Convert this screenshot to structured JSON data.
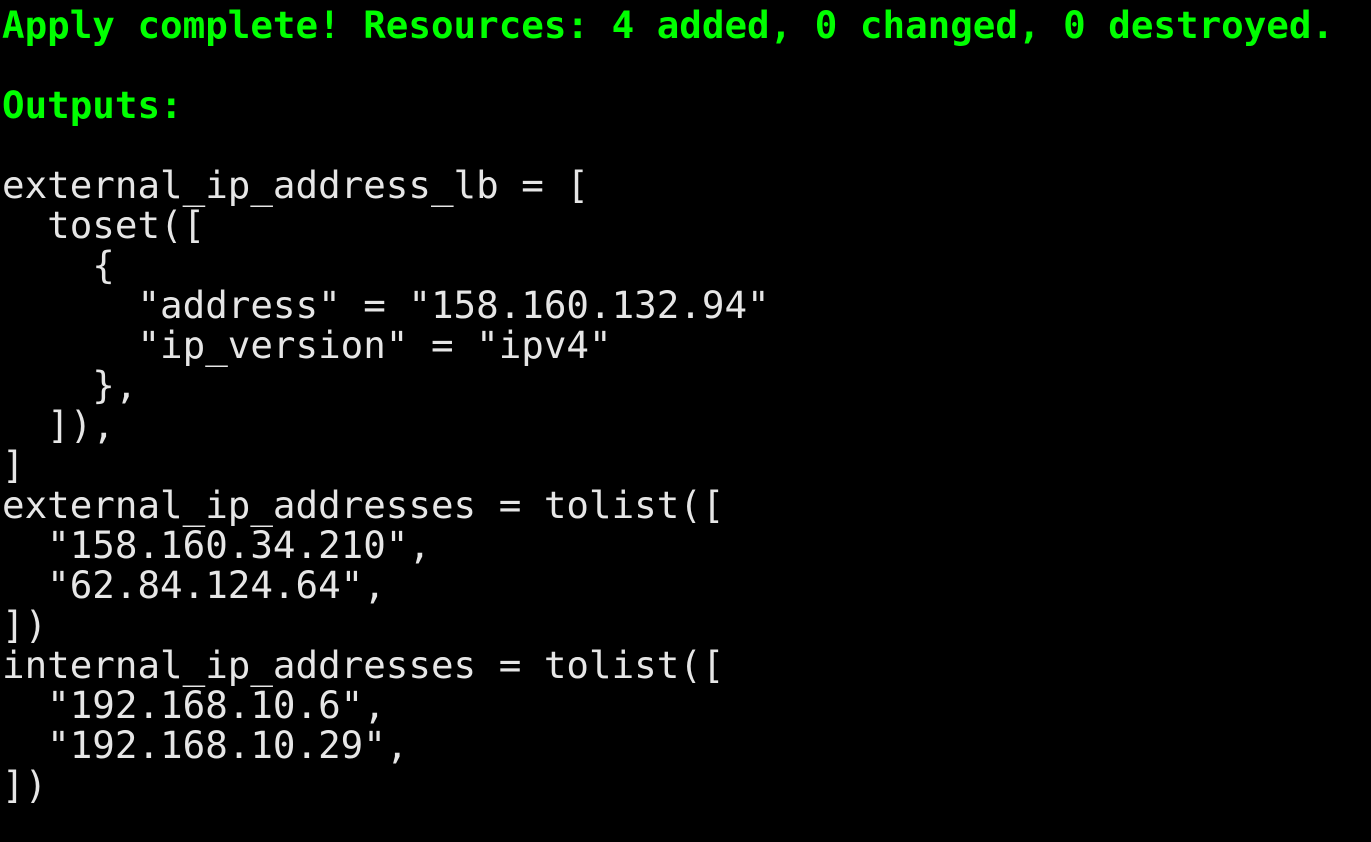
{
  "colors": {
    "background": "#000000",
    "success_text": "#00ff00",
    "output_text": "#e6e6e6"
  },
  "terminal": {
    "lines": [
      "Apply complete! Resources: 4 added, 0 changed, 0 destroyed.",
      "",
      "Outputs:",
      "",
      "external_ip_address_lb = [",
      "  toset([",
      "    {",
      "      \"address\" = \"158.160.132.94\"",
      "      \"ip_version\" = \"ipv4\"",
      "    },",
      "  ]),",
      "]",
      "external_ip_addresses = tolist([",
      "  \"158.160.34.210\",",
      "  \"62.84.124.64\",",
      "])",
      "internal_ip_addresses = tolist([",
      "  \"192.168.10.6\",",
      "  \"192.168.10.29\",",
      "])"
    ]
  }
}
